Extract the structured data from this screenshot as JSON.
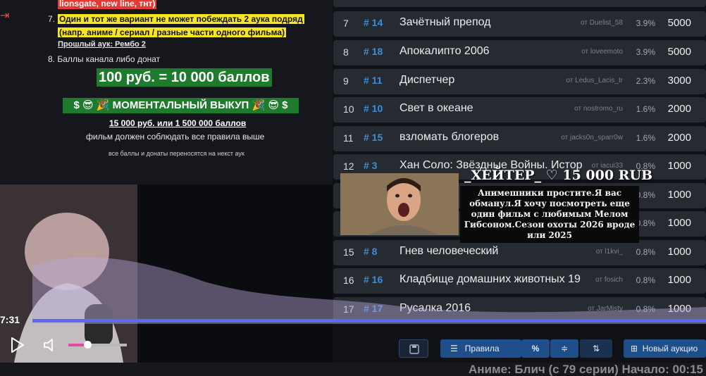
{
  "rules": {
    "rule6_tail": "lionsgate, new line, тнт)",
    "rule7_num": "7.",
    "rule7_line1": "Один и тот же вариант не может побеждать 2 аука подряд",
    "rule7_line2": "(напр. аниме / сериал / разные части одного фильма)",
    "previous_auction": "Прошлый аук: Рембо 2",
    "rule8": "8. Баллы канала либо донат",
    "price": "100 руб. = 10 000 баллов",
    "buyout_banner": "$ 😎 🎉 МОМЕНТАЛЬНЫЙ ВЫКУП 🎉 😎 $",
    "buyout_price": "15 000 руб. или 1 500 000 баллов",
    "buyout_note": "фильм должен соблюдать все правила выше",
    "transfer_note": "все баллы и донаты переносятся на некст аук"
  },
  "lots": [
    {
      "num": "7",
      "tag": "# 14",
      "title": "Зачётный препод",
      "by": "от Duelist_58",
      "pct": "3.9%",
      "amount": "5000"
    },
    {
      "num": "8",
      "tag": "# 18",
      "title": "Апокалипто 2006",
      "by": "от loveemoto",
      "pct": "3.9%",
      "amount": "5000"
    },
    {
      "num": "9",
      "tag": "# 11",
      "title": "Диспетчер",
      "by": "от Ledus_Lacis_Ir",
      "pct": "2.3%",
      "amount": "3000"
    },
    {
      "num": "10",
      "tag": "# 10",
      "title": "Свет в океане",
      "by": "от nostromo_ru",
      "pct": "1.6%",
      "amount": "2000"
    },
    {
      "num": "11",
      "tag": "# 15",
      "title": "взломать блогеров",
      "by": "от jacks0n_sparr0w",
      "pct": "1.6%",
      "amount": "2000"
    },
    {
      "num": "12",
      "tag": "# 3",
      "title": "Хан Соло: Звёздные Войны. Истор",
      "by": "от iacui33",
      "pct": "0.8%",
      "amount": "1000"
    },
    {
      "num": "13",
      "tag": "",
      "title": "",
      "by": "",
      "pct": "0.8%",
      "amount": "1000"
    },
    {
      "num": "14",
      "tag": "",
      "title": "",
      "by": "",
      "pct": "0.8%",
      "amount": "1000"
    },
    {
      "num": "15",
      "tag": "# 8",
      "title": "Гнев человеческий",
      "by": "от l1kvi_",
      "pct": "0.8%",
      "amount": "1000"
    },
    {
      "num": "16",
      "tag": "# 16",
      "title": "Кладбище домашних животных  19",
      "by": "от fosich",
      "pct": "0.8%",
      "amount": "1000"
    },
    {
      "num": "17",
      "tag": "# 17",
      "title": "Русалка 2016",
      "by": "от JarMisty",
      "pct": "0.8%",
      "amount": "1000"
    }
  ],
  "toolbar": {
    "rules_label": "Правила",
    "pct_label": "%",
    "new_auction_label": "Новый аукцио"
  },
  "alert": {
    "header": "_ХЕЙТЕР_ ♡ 15 000 RUB",
    "message": "Анимешники простите.Я вас обманул.Я хочу посмотреть еще один фильм с любимым Мелом Гибсоном.Сезон охоты 2026 вроде или 2025"
  },
  "player": {
    "time": "7:31",
    "progress_fraction": 1.0,
    "volume_fraction": 0.3
  },
  "ticker": {
    "text": "Аниме: Блич (с 79 серии) Начало: 00:15"
  },
  "colors": {
    "accent_blue": "#3d8ed8",
    "progress_blue": "#5a6bf2",
    "volume_pink": "#e64aa0",
    "highlight_yellow": "#f5e524",
    "banner_green": "#1e7a2c"
  }
}
